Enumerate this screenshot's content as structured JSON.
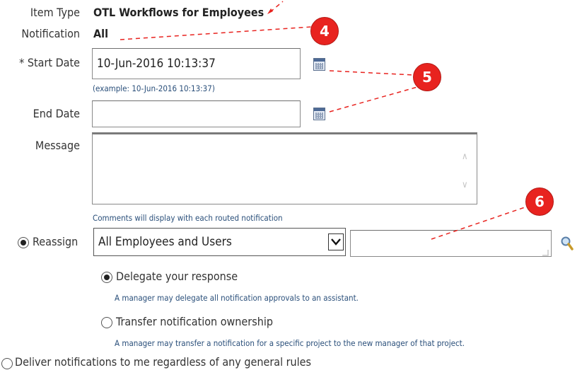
{
  "fields": {
    "item_type": {
      "label": "Item Type",
      "value": "OTL Workflows for Employees"
    },
    "notification": {
      "label": "Notification",
      "value": "All"
    },
    "start_date": {
      "label": "* Start Date",
      "value": "10-Jun-2016 10:13:37",
      "hint": "(example: 10-Jun-2016 10:13:37)"
    },
    "end_date": {
      "label": "End Date",
      "value": ""
    },
    "message": {
      "label": "Message",
      "value": "",
      "hint": "Comments will display with each routed notification"
    }
  },
  "reassign": {
    "label": "Reassign",
    "selected": true,
    "select_value": "All Employees and Users",
    "search_value": "",
    "options": [
      {
        "label": "Delegate your response",
        "selected": true,
        "hint": "A manager may delegate all notification approvals to an assistant."
      },
      {
        "label": "Transfer notification ownership",
        "selected": false,
        "hint": "A manager may transfer a notification for a specific project to the new manager of that project."
      }
    ]
  },
  "deliver": {
    "label": "Deliver notifications to me regardless of any general rules",
    "selected": false
  },
  "annotations": {
    "badges": [
      "4",
      "5",
      "6"
    ],
    "color": "#e8231f"
  },
  "icons": {
    "calendar": "calendar-icon",
    "search": "search-icon",
    "scroll_up": "chevron-up-icon",
    "scroll_down": "chevron-down-icon",
    "select_arrow": "chevron-down-icon",
    "resize": "resize-handle-icon"
  }
}
